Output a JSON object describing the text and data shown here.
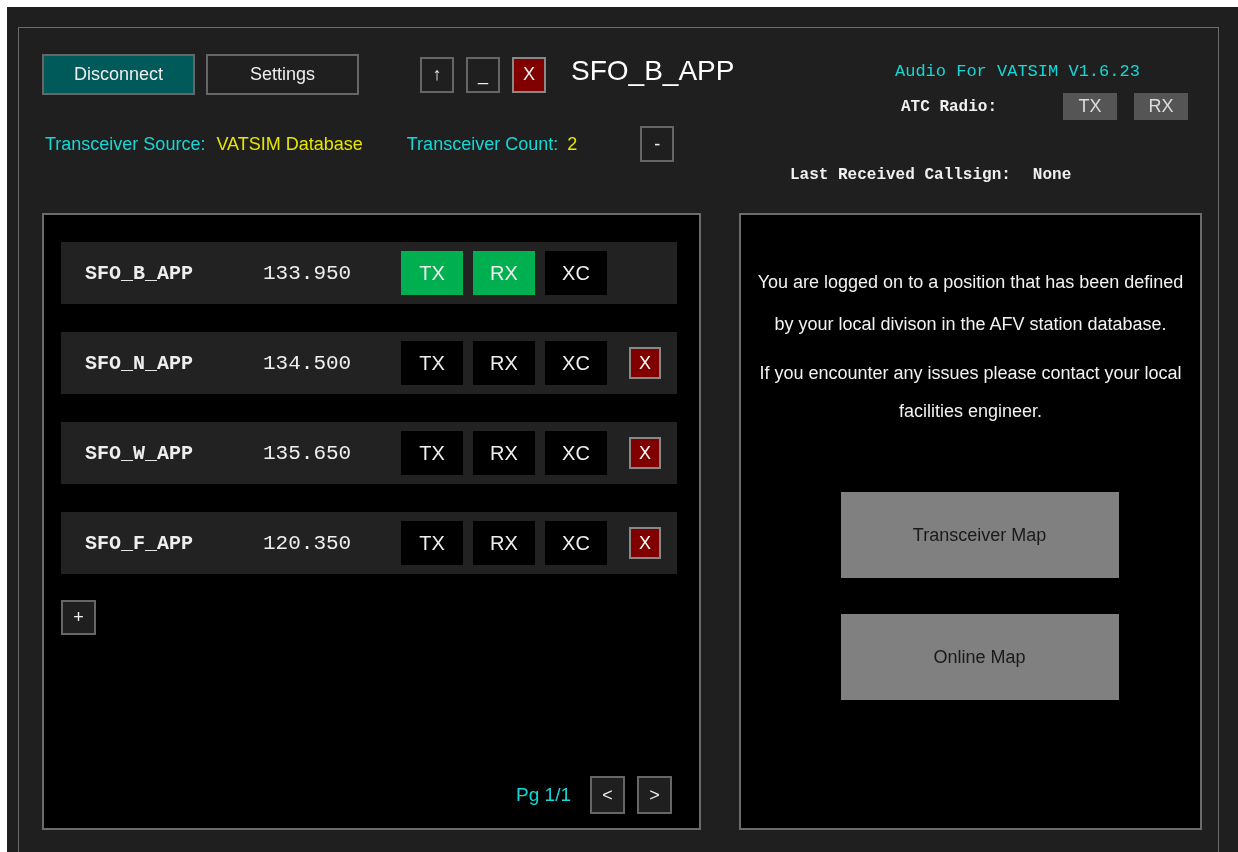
{
  "header": {
    "buttons": [
      {
        "kind": "connect",
        "label": "Disconnect"
      },
      {
        "kind": "plain",
        "label": "Settings"
      }
    ],
    "window_buttons": [
      {
        "kind": "plain",
        "label": "↑"
      },
      {
        "kind": "plain",
        "label": "_"
      },
      {
        "kind": "close",
        "label": "X"
      }
    ],
    "callsign": "SFO_B_APP",
    "source_label": "Transceiver Source:",
    "source_value": "VATSIM Database",
    "count_label": "Transceiver Count:",
    "count_value": "2",
    "collapse_button": "-",
    "version": "Audio For VATSIM V1.6.23",
    "atc_radio_label": "ATC Radio:",
    "atc_radio_buttons": [
      {
        "label": "TX",
        "on": false
      },
      {
        "label": "RX",
        "on": false
      }
    ],
    "last_received_label": "Last Received Callsign:",
    "last_received_value": "None"
  },
  "stations": [
    {
      "callsign": "SFO_B_APP",
      "frequency": "133.950",
      "toggles": [
        {
          "label": "TX",
          "on": true
        },
        {
          "label": "RX",
          "on": true
        },
        {
          "label": "XC",
          "on": false
        }
      ]
    },
    {
      "callsign": "SFO_N_APP",
      "frequency": "134.500",
      "toggles": [
        {
          "label": "TX",
          "on": false
        },
        {
          "label": "RX",
          "on": false
        },
        {
          "label": "XC",
          "on": false
        }
      ],
      "remove_button": "X"
    },
    {
      "callsign": "SFO_W_APP",
      "frequency": "135.650",
      "toggles": [
        {
          "label": "TX",
          "on": false
        },
        {
          "label": "RX",
          "on": false
        },
        {
          "label": "XC",
          "on": false
        }
      ],
      "remove_button": "X"
    },
    {
      "callsign": "SFO_F_APP",
      "frequency": "120.350",
      "toggles": [
        {
          "label": "TX",
          "on": false
        },
        {
          "label": "RX",
          "on": false
        },
        {
          "label": "XC",
          "on": false
        }
      ],
      "remove_button": "X"
    }
  ],
  "add_button": "+",
  "pager": {
    "label": "Pg 1/1",
    "prev": "<",
    "next": ">"
  },
  "info": {
    "paragraphs": [
      "You are logged on to a position that has been defined by your local divison in the AFV station database.",
      "If you encounter any issues please contact your local facilities engineer."
    ],
    "buttons": [
      "Transceiver Map",
      "Online Map"
    ]
  }
}
